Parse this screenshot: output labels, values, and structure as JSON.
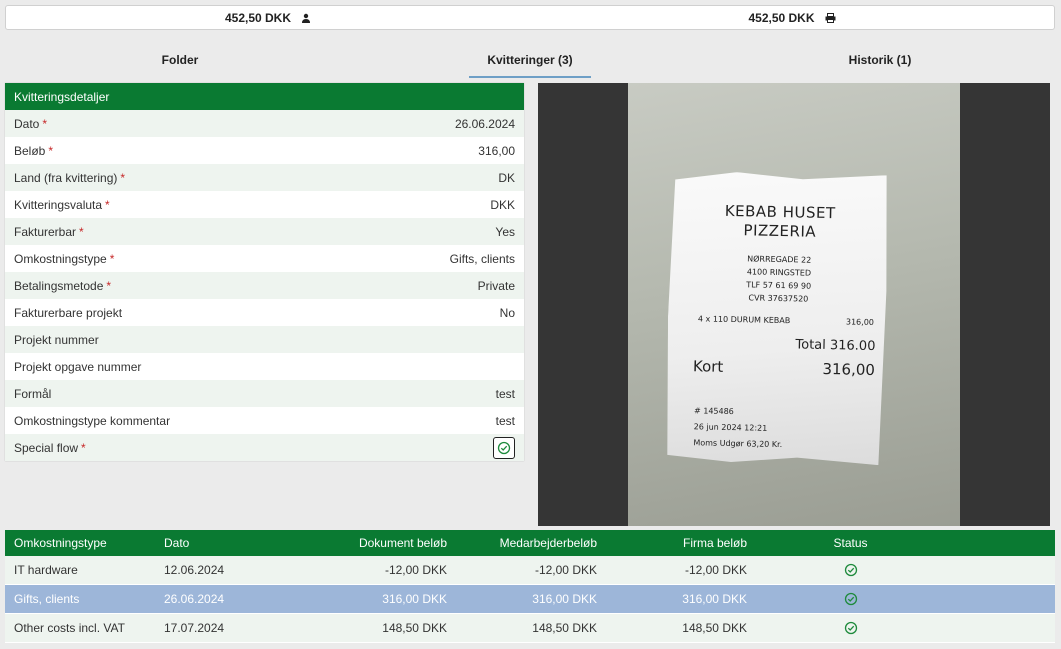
{
  "topbar": {
    "employee_amount": "452,50 DKK",
    "company_amount": "452,50 DKK",
    "employee_icon": "person-icon",
    "company_icon": "printer-icon"
  },
  "tabs": [
    {
      "label": "Folder",
      "active": false
    },
    {
      "label": "Kvitteringer (3)",
      "active": true
    },
    {
      "label": "Historik (1)",
      "active": false
    }
  ],
  "details": {
    "header": "Kvitteringsdetaljer",
    "rows": [
      {
        "label": "Dato",
        "required": true,
        "value": "26.06.2024"
      },
      {
        "label": "Beløb",
        "required": true,
        "value": "316,00"
      },
      {
        "label": "Land (fra kvittering)",
        "required": true,
        "value": "DK"
      },
      {
        "label": "Kvitteringsvaluta",
        "required": true,
        "value": "DKK"
      },
      {
        "label": "Fakturerbar",
        "required": true,
        "value": "Yes"
      },
      {
        "label": "Omkostningstype",
        "required": true,
        "value": "Gifts, clients"
      },
      {
        "label": "Betalingsmetode",
        "required": true,
        "value": "Private"
      },
      {
        "label": "Fakturerbare projekt",
        "required": false,
        "value": "No"
      },
      {
        "label": "Projekt nummer",
        "required": false,
        "value": ""
      },
      {
        "label": "Projekt opgave nummer",
        "required": false,
        "value": ""
      },
      {
        "label": "Formål",
        "required": false,
        "value": "test"
      },
      {
        "label": "Omkostningstype kommentar",
        "required": false,
        "value": "test"
      },
      {
        "label": "Special flow",
        "required": true,
        "value": ""
      }
    ],
    "required_mark": "*"
  },
  "receipt_image": {
    "title_line1": "KEBAB HUSET",
    "title_line2": "PIZZERIA",
    "address1": "NØRREGADE 22",
    "address2": "4100 RINGSTED",
    "phone": "TLF   57 61 69 90",
    "cvr": "CVR 37637520",
    "item": "4 x  110 DURUM KEBAB",
    "item_amount": "316,00",
    "total": "Total 316.00",
    "kort_label": "Kort",
    "kort_amount": "316,00",
    "ref": "# 145486",
    "datetime": "26 jun 2024 12:21",
    "vat": "Moms Udgør   63,20 Kr."
  },
  "grid": {
    "columns": [
      "Omkostningstype",
      "Dato",
      "Dokument beløb",
      "Medarbejderbeløb",
      "Firma beløb",
      "Status"
    ],
    "rows": [
      {
        "type": "IT hardware",
        "date": "12.06.2024",
        "doc": "-12,00 DKK",
        "emp": "-12,00 DKK",
        "firm": "-12,00 DKK",
        "status_icon": "check-circle-icon",
        "selected": false
      },
      {
        "type": "Gifts, clients",
        "date": "26.06.2024",
        "doc": "316,00 DKK",
        "emp": "316,00 DKK",
        "firm": "316,00 DKK",
        "status_icon": "check-circle-icon",
        "selected": true
      },
      {
        "type": "Other costs incl. VAT",
        "date": "17.07.2024",
        "doc": "148,50 DKK",
        "emp": "148,50 DKK",
        "firm": "148,50 DKK",
        "status_icon": "check-circle-icon",
        "selected": false
      }
    ]
  },
  "colors": {
    "header_green": "#0a7a32",
    "row_alt": "#eef4ef",
    "selected_row": "#9db6d9",
    "required_red": "#c62828",
    "check_green": "#1e8a3c"
  }
}
